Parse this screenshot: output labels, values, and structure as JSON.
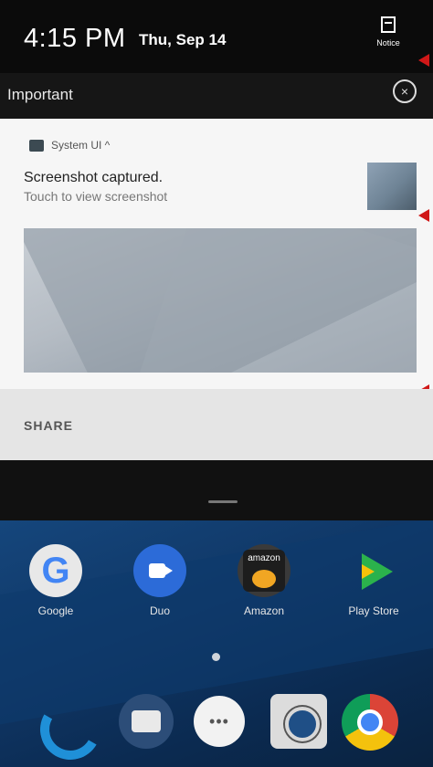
{
  "status_bar": {
    "time": "4:15 PM",
    "date": "Thu, Sep 14",
    "notice_label": "Notice"
  },
  "section": {
    "label": "Important",
    "close_icon": "close-circle-icon"
  },
  "notification": {
    "app_name": "System UI ^",
    "title": "Screenshot captured.",
    "subtitle": "Touch to view screenshot",
    "action": "SHARE"
  },
  "home_apps": [
    {
      "label": "Google"
    },
    {
      "label": "Duo"
    },
    {
      "label": "Amazon",
      "icon_text": "amazon"
    },
    {
      "label": "Play Store"
    }
  ],
  "dock_apps_icon_text": "•••",
  "colors": {
    "annotation_arrow": "#d01818",
    "card_bg": "#f6f6f6",
    "share_bar_bg": "#e5e5e5"
  }
}
